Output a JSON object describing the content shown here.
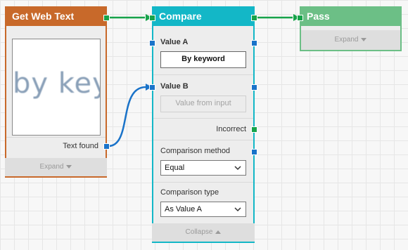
{
  "nodes": {
    "get_web_text": {
      "title": "Get Web Text",
      "preview_text": "by keyw",
      "output_label": "Text found",
      "footer_label": "Expand",
      "accent": "#c8692a"
    },
    "compare": {
      "title": "Compare",
      "value_a_label": "Value A",
      "value_a_value": "By keyword",
      "value_b_label": "Value B",
      "value_b_placeholder": "Value from input",
      "incorrect_label": "Incorrect",
      "comparison_method_label": "Comparison method",
      "comparison_method_value": "Equal",
      "comparison_type_label": "Comparison type",
      "comparison_type_value": "As Value A",
      "footer_label": "Collapse",
      "accent": "#13b7c7"
    },
    "pass": {
      "title": "Pass",
      "footer_label": "Expand",
      "accent": "#6cbf86"
    }
  },
  "colors": {
    "link_green": "#17a34a",
    "link_blue": "#1a73c9"
  }
}
